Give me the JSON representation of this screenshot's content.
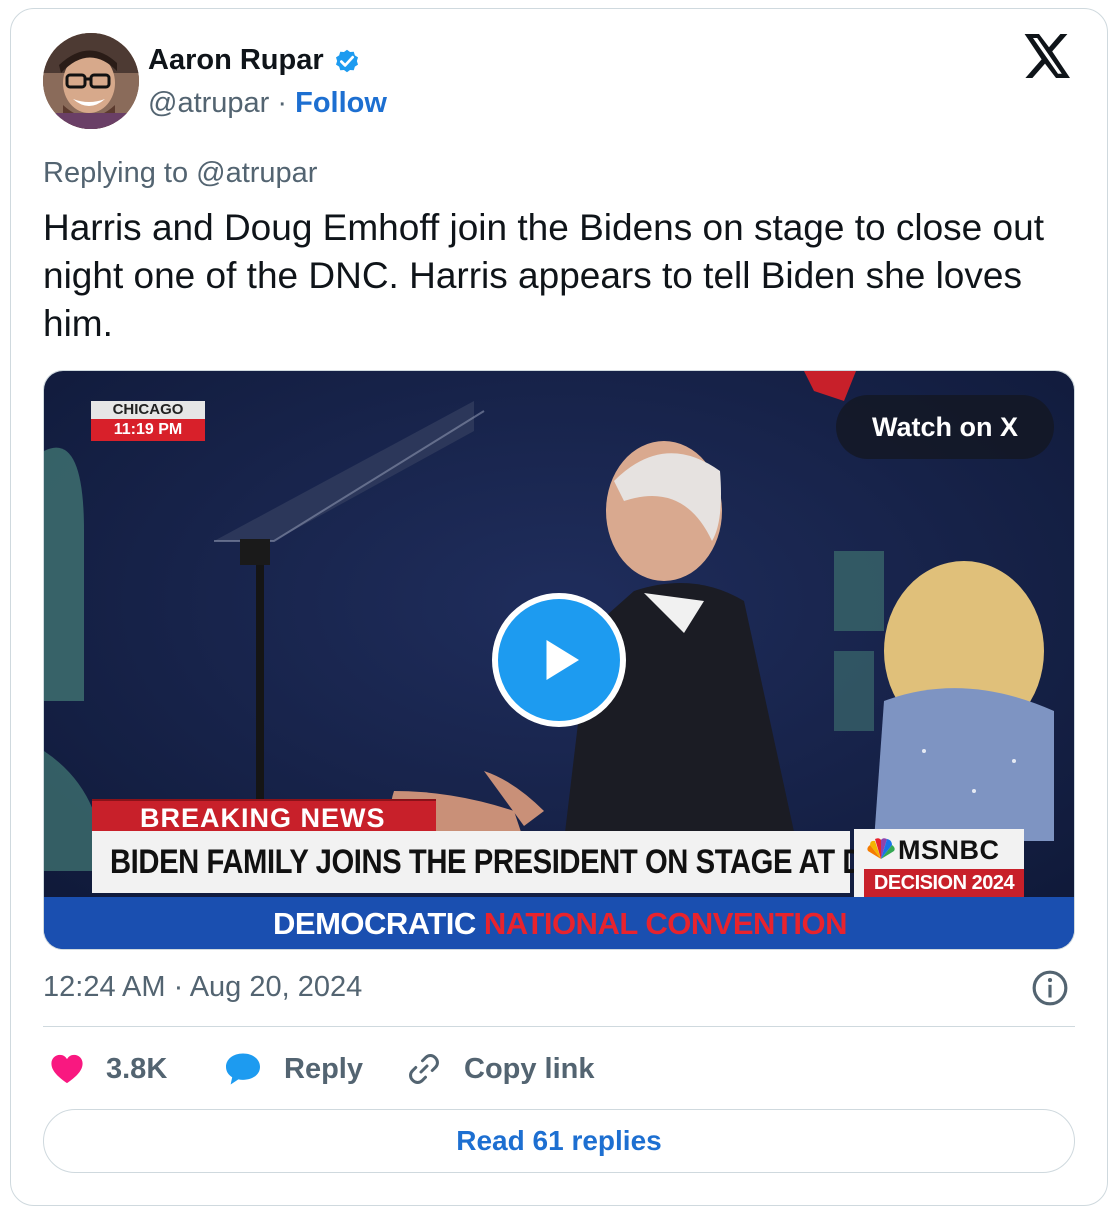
{
  "author": {
    "name": "Aaron Rupar",
    "handle": "@atrupar",
    "separator": "·",
    "follow_label": "Follow",
    "verified_icon": "verified-badge-icon"
  },
  "tweet": {
    "reply_to": "Replying to @atrupar",
    "text": "Harris and Doug Emhoff join the Bidens on stage to close out night one of the DNC. Harris appears to tell Biden she loves him.",
    "timestamp": "12:24 AM · Aug 20, 2024"
  },
  "video": {
    "watch_label": "Watch on X",
    "location_city": "CHICAGO",
    "location_time": "11:19 PM",
    "breaking_label": "BREAKING NEWS",
    "headline": "BIDEN FAMILY JOINS THE PRESIDENT ON STAGE AT DNC",
    "network": "MSNBC",
    "decision_label": "DECISION 2024",
    "convention_part1": "DEMOCRATIC",
    "convention_part2": "NATIONAL CONVENTION"
  },
  "actions": {
    "likes": "3.8K",
    "reply_label": "Reply",
    "copy_label": "Copy link",
    "read_replies": "Read 61 replies"
  },
  "colors": {
    "accent": "#1d6fd1",
    "like": "#f91880",
    "reply_icon": "#1d9bf0",
    "muted": "#536471"
  }
}
